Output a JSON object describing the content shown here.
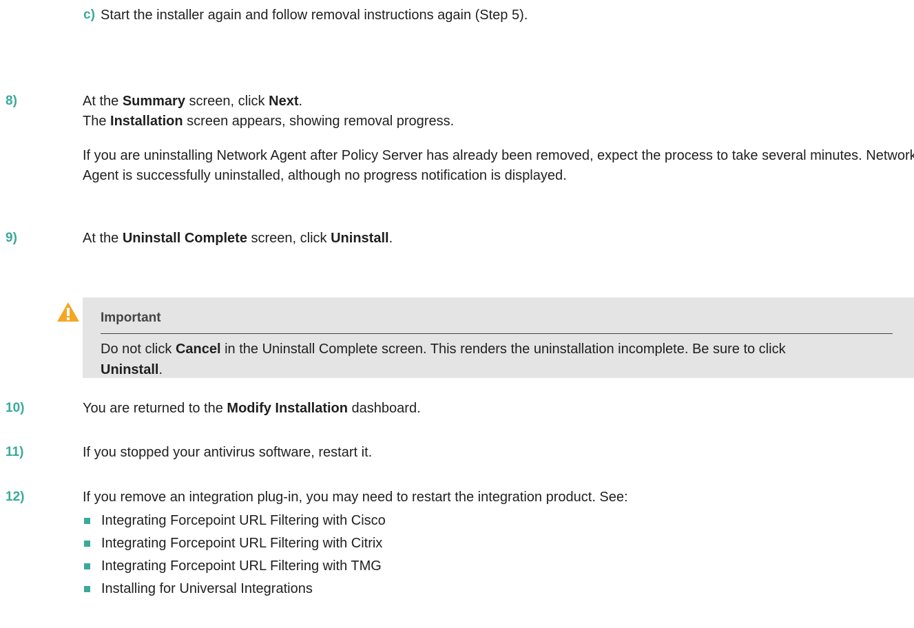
{
  "steps": {
    "c": {
      "num": "c)",
      "text": "Start the installer again and follow removal instructions again (Step 5)."
    },
    "s8": {
      "num": "8)",
      "line1_a": "At the ",
      "line1_b": "Summary",
      "line1_c": " screen, click ",
      "line1_d": "Next",
      "line1_e": ".",
      "line2_a": "The ",
      "line2_b": "Installation",
      "line2_c": " screen appears, showing removal progress.",
      "para": "If you are uninstalling Network Agent after Policy Server has already been removed, expect the process to take several minutes. Network Agent is successfully uninstalled, although no progress notification is displayed."
    },
    "s9": {
      "num": "9)",
      "line_a": "At the ",
      "line_b": "Uninstall Complete",
      "line_c": " screen, click ",
      "line_d": "Uninstall",
      "line_e": "."
    },
    "callout": {
      "icon": "warning-icon",
      "title": "Important",
      "body_a": "Do not click ",
      "body_b": "Cancel",
      "body_c": " in the Uninstall Complete screen. This renders the uninstallation incomplete. Be sure to click ",
      "body_d": "Uninstall",
      "body_e": "."
    },
    "s10": {
      "num": "10)",
      "line_a": "You are returned to the ",
      "line_b": "Modify Installation",
      "line_c": " dashboard."
    },
    "s11": {
      "num": "11)",
      "text": "If you stopped your antivirus software, restart it."
    },
    "s12": {
      "num": "12)",
      "text": "If you remove an integration plug-in, you may need to restart the integration product. See:",
      "bullets": [
        "Integrating Forcepoint URL Filtering with Cisco",
        "Integrating Forcepoint URL Filtering with Citrix",
        "Integrating Forcepoint URL Filtering with TMG",
        "Installing for Universal Integrations"
      ]
    }
  },
  "colors": {
    "accent": "#3aa99a",
    "callout_bg": "#e4e4e4",
    "warning": "#f5a623"
  }
}
